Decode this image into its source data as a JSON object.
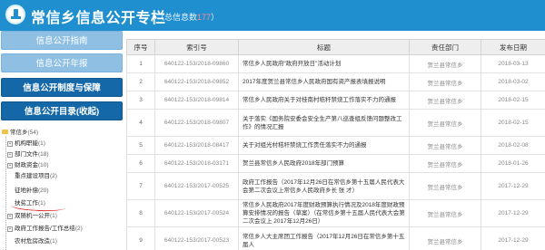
{
  "header": {
    "title": "常信乡信息公开专栏",
    "total_prefix": "（总信息数",
    "total_count": "177",
    "total_suffix": "）"
  },
  "sidebar": {
    "menu": [
      {
        "label": "信息公开指南"
      },
      {
        "label": "信息公开年报"
      },
      {
        "label": "信息公开制度与保障"
      },
      {
        "label": "信息公开目录(收起)"
      }
    ],
    "tree": [
      {
        "label": "常信乡",
        "count": "(54)",
        "toggle": "-"
      },
      {
        "label": "机构职能",
        "count": "(1)",
        "toggle": "+"
      },
      {
        "label": "部门文件",
        "count": "(18)",
        "toggle": "+"
      },
      {
        "label": "财政资金",
        "count": "(10)",
        "toggle": "+"
      },
      {
        "label": "重点建设项目",
        "count": "(2)",
        "toggle": ""
      },
      {
        "label": "征地补偿",
        "count": "(20)",
        "toggle": ""
      },
      {
        "label": "扶贫工作",
        "count": "(1)",
        "toggle": ""
      },
      {
        "label": "双随机一公开",
        "count": "(1)",
        "toggle": "+"
      },
      {
        "label": "政府工作报告/工作总结",
        "count": "(2)",
        "toggle": "+"
      },
      {
        "label": "农村危房改造",
        "count": "(1)",
        "toggle": ""
      }
    ]
  },
  "table": {
    "headers": [
      "序号",
      "索引号",
      "标题",
      "责任部门",
      "发布日期"
    ],
    "rows": [
      {
        "no": "1",
        "index": "640122-153/2018-09860",
        "title": "常信乡人民政府“政府开放日”活动计划",
        "dept": "贺兰县常信乡",
        "date": "2018-03-13"
      },
      {
        "no": "2",
        "index": "640122-153/2018-09852",
        "title": "2017年度贺兰县常信乡人民政府国有资产报表填报说明",
        "dept": "贺兰县常信乡",
        "date": "2018-03-02"
      },
      {
        "no": "3",
        "index": "640122-153/2018-09814",
        "title": "常信乡人民政府关于对桂南村秸秆禁烧工作落实不力的通报",
        "dept": "贺兰县常信乡",
        "date": "2018-02-15"
      },
      {
        "no": "4",
        "index": "640122-153/2018-09807",
        "title": "关于落实《国务院安委会安全生产第八巡查组反馈问题整改工作》的情况汇报",
        "dept": "贺兰县常信乡",
        "date": "2018-02-15"
      },
      {
        "no": "5",
        "index": "640122-153/2018-08417",
        "title": "关于对组光村秸秆禁烧工作责任落实不力的通报",
        "dept": "贺兰县常信乡",
        "date": "2018-02-08"
      },
      {
        "no": "6",
        "index": "640122-153/2018-03171",
        "title": "贺兰县常信乡人民政府2018年部门预算",
        "dept": "贺兰县常信乡",
        "date": "2018-01-26"
      },
      {
        "no": "7",
        "index": "640122-153/2017-00525",
        "title": "政府工作报告（2017年12月26日在常信乡第十五届人民代表大会第二次会议上常信乡人民政府乡长 张 才）",
        "dept": "贺兰县常信乡",
        "date": "2017-12-29"
      },
      {
        "no": "8",
        "index": "640122-153/2017-00524",
        "title": "常信乡人民政府2017年度财政预算执行情况及2018年度财政预算安排情况的报告（草案）（在常信乡第十五届人民代表大会第二次会议上 2017年12月26日）",
        "dept": "贺兰县常信乡",
        "date": "2017-12-29"
      },
      {
        "no": "9",
        "index": "640122-153/2017-00523",
        "title": "常信乡人大主席团工作报告（2017年12月26日在常信乡第十五届人",
        "dept": "贺兰县常信乡",
        "date": "2017-12-29"
      }
    ]
  }
}
